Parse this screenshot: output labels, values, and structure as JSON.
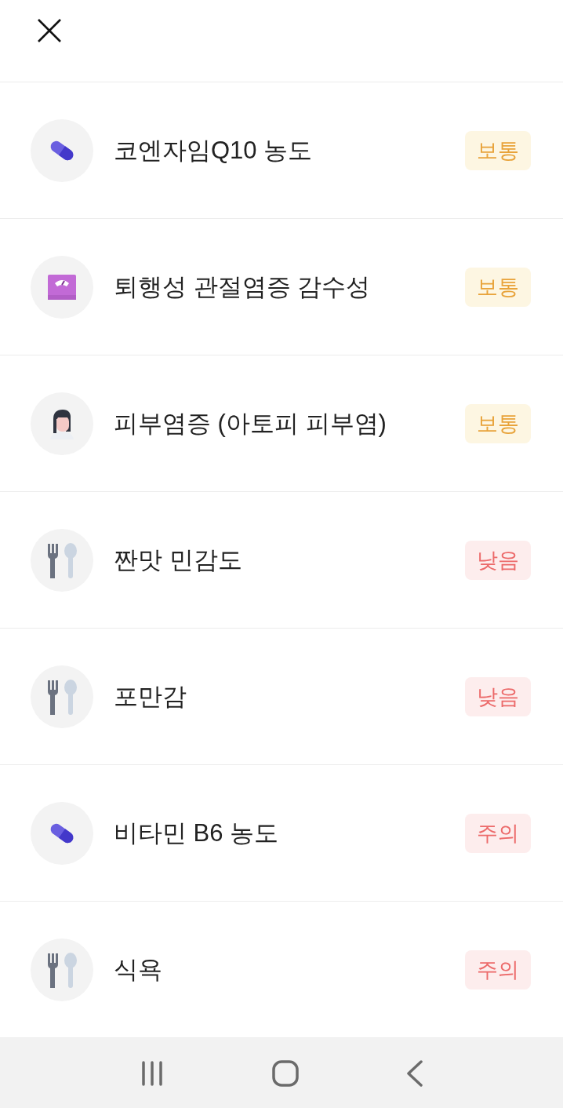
{
  "items": [
    {
      "kind": "pill",
      "label": "코엔자임Q10 농도",
      "badge": {
        "text": "보통",
        "kind": "normal"
      }
    },
    {
      "kind": "scale",
      "label": "퇴행성 관절염증 감수성",
      "badge": {
        "text": "보통",
        "kind": "normal"
      }
    },
    {
      "kind": "person",
      "label": "피부염증 (아토피 피부염)",
      "badge": {
        "text": "보통",
        "kind": "normal"
      }
    },
    {
      "kind": "utensils",
      "label": "짠맛 민감도",
      "badge": {
        "text": "낮음",
        "kind": "alert"
      }
    },
    {
      "kind": "utensils",
      "label": "포만감",
      "badge": {
        "text": "낮음",
        "kind": "alert"
      }
    },
    {
      "kind": "pill",
      "label": "비타민 B6 농도",
      "badge": {
        "text": "주의",
        "kind": "alert"
      }
    },
    {
      "kind": "utensils",
      "label": "식욕",
      "badge": {
        "text": "주의",
        "kind": "alert"
      }
    }
  ]
}
